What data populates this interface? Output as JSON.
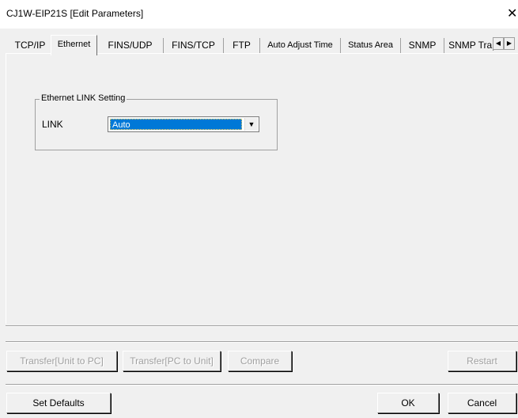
{
  "window": {
    "title": "CJ1W-EIP21S [Edit Parameters]",
    "close_glyph": "✕"
  },
  "tabs": [
    {
      "label": "TCP/IP",
      "active": false
    },
    {
      "label": "Ethernet",
      "active": true
    },
    {
      "label": "FINS/UDP",
      "active": false
    },
    {
      "label": "FINS/TCP",
      "active": false
    },
    {
      "label": "FTP",
      "active": false
    },
    {
      "label": "Auto Adjust Time",
      "active": false
    },
    {
      "label": "Status Area",
      "active": false
    },
    {
      "label": "SNMP",
      "active": false
    },
    {
      "label": "SNMP Trap",
      "active": false
    }
  ],
  "tab_scroll": {
    "left_icon": "arrow-left-icon",
    "right_icon": "arrow-right-icon",
    "left_glyph": "◀",
    "right_glyph": "▶"
  },
  "ethernet": {
    "group_title": "Ethernet LINK Setting",
    "link_label": "LINK",
    "link_value": "Auto",
    "dropdown_glyph": "▼"
  },
  "actions": {
    "transfer_unit_to_pc": "Transfer[Unit to PC]",
    "transfer_pc_to_unit": "Transfer[PC to Unit]",
    "compare": "Compare",
    "restart": "Restart"
  },
  "footer": {
    "set_defaults": "Set Defaults",
    "ok": "OK",
    "cancel": "Cancel"
  },
  "colors": {
    "selection": "#0078d7",
    "face": "#f0f0f0",
    "disabled_text": "#a0a0a0"
  }
}
